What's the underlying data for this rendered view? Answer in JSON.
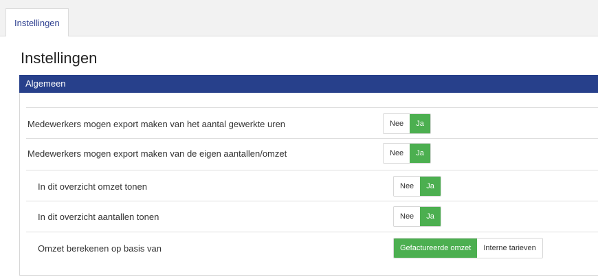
{
  "tabs": [
    {
      "label": "Instellingen"
    }
  ],
  "page": {
    "title": "Instellingen"
  },
  "section": {
    "title": "Algemeen",
    "rows": [
      {
        "label": "Medewerkers mogen export maken van het aantal gewerkte uren",
        "options": [
          "Nee",
          "Ja"
        ],
        "selected": "Ja"
      },
      {
        "label": "Medewerkers mogen export maken van de eigen aantallen/omzet",
        "options": [
          "Nee",
          "Ja"
        ],
        "selected": "Ja"
      },
      {
        "label": "In dit overzicht omzet tonen",
        "options": [
          "Nee",
          "Ja"
        ],
        "selected": "Ja"
      },
      {
        "label": "In dit overzicht aantallen tonen",
        "options": [
          "Nee",
          "Ja"
        ],
        "selected": "Ja"
      },
      {
        "label": "Omzet berekenen op basis van",
        "options": [
          "Gefactureerde omzet",
          "Interne tarieven"
        ],
        "selected": "Gefactureerde omzet"
      }
    ]
  },
  "colors": {
    "header_bg": "#27408b",
    "active_toggle": "#4caf50",
    "tab_text": "#2c3e8f"
  }
}
